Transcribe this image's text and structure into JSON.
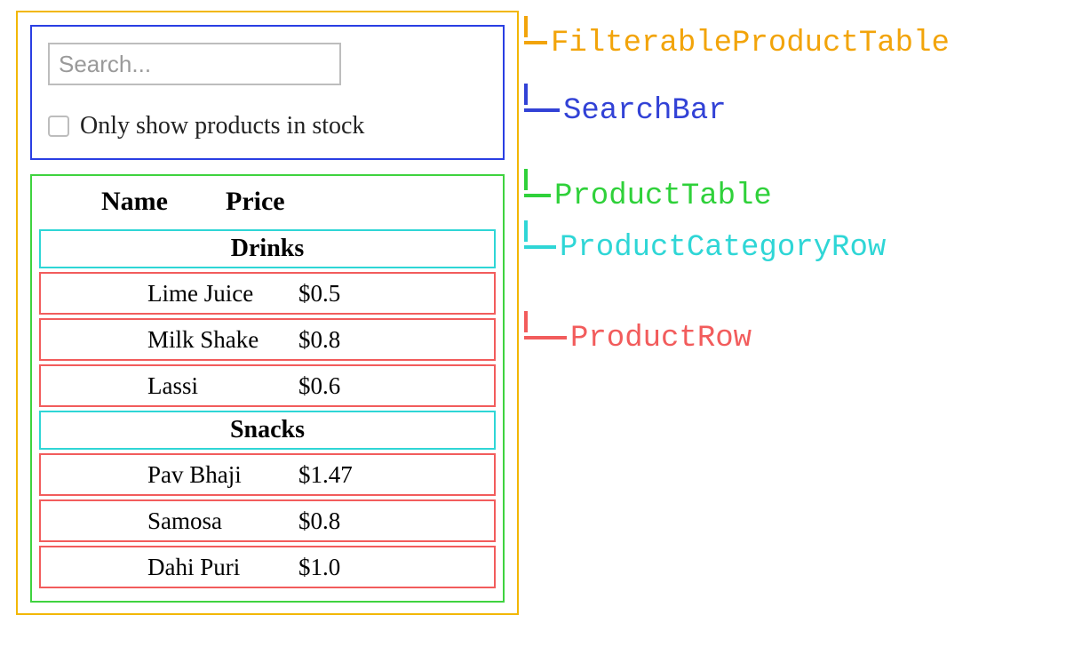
{
  "search": {
    "placeholder": "Search...",
    "checkbox_label": "Only show products in stock"
  },
  "table": {
    "headers": {
      "name": "Name",
      "price": "Price"
    },
    "rows": [
      {
        "kind": "category",
        "label": "Drinks"
      },
      {
        "kind": "product",
        "name": "Lime Juice",
        "price": "$0.5"
      },
      {
        "kind": "product",
        "name": "Milk Shake",
        "price": "$0.8"
      },
      {
        "kind": "product",
        "name": "Lassi",
        "price": "$0.6"
      },
      {
        "kind": "category",
        "label": "Snacks"
      },
      {
        "kind": "product",
        "name": "Pav Bhaji",
        "price": "$1.47"
      },
      {
        "kind": "product",
        "name": "Samosa",
        "price": "$0.8"
      },
      {
        "kind": "product",
        "name": "Dahi Puri",
        "price": "$1.0"
      }
    ]
  },
  "labels": [
    {
      "text": "FilterableProductTable",
      "color": "orange"
    },
    {
      "text": "SearchBar",
      "color": "blue"
    },
    {
      "text": "ProductTable",
      "color": "green"
    },
    {
      "text": "ProductCategoryRow",
      "color": "cyan"
    },
    {
      "text": "ProductRow",
      "color": "red"
    }
  ],
  "colors": {
    "orange": "#f2a40a",
    "blue": "#3242d6",
    "green": "#2fd13a",
    "cyan": "#2fd6d6",
    "red": "#f25c5c"
  }
}
